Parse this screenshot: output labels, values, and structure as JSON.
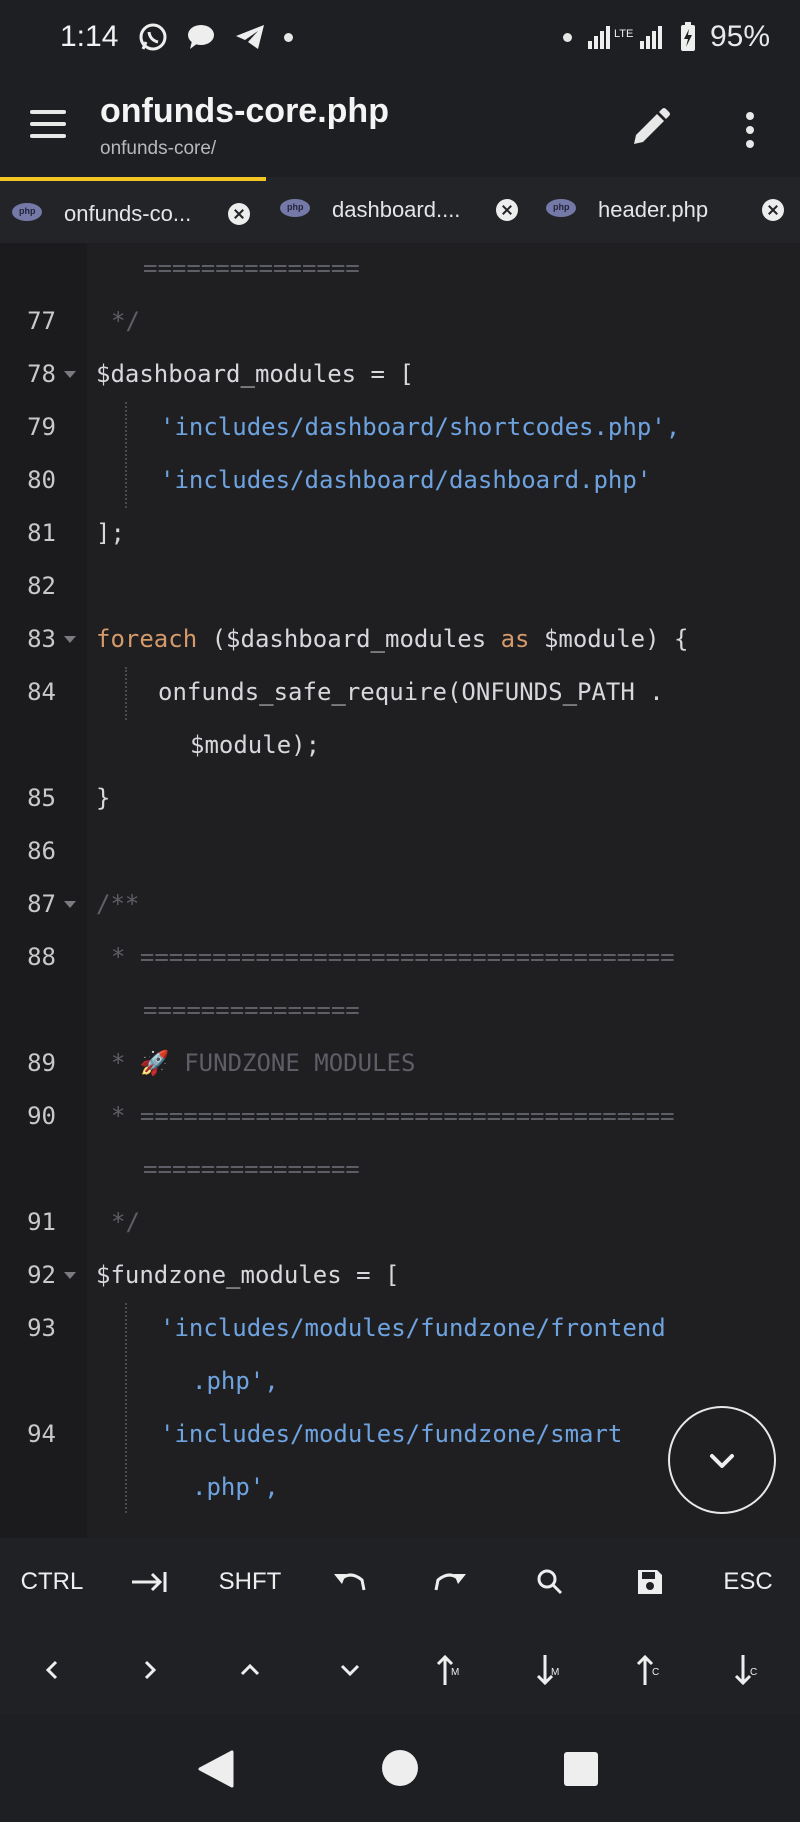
{
  "status_bar": {
    "time": "1:14",
    "battery": "95%",
    "network": "LTE"
  },
  "app_bar": {
    "title": "onfunds-core.php",
    "subtitle": "onfunds-core/"
  },
  "tabs": [
    {
      "label": "onfunds-co...",
      "icon": "php-icon",
      "active": true
    },
    {
      "label": "dashboard....",
      "icon": "php-icon",
      "active": false
    },
    {
      "label": "header.php",
      "icon": "php-icon",
      "active": false
    }
  ],
  "code_lines": [
    {
      "n": "",
      "text": "==============="
    },
    {
      "n": "77",
      "text": "*/"
    },
    {
      "n": "78",
      "text": "$dashboard_modules = ["
    },
    {
      "n": "79",
      "text": "'includes/dashboard/shortcodes.php',"
    },
    {
      "n": "80",
      "text": "'includes/dashboard/dashboard.php'"
    },
    {
      "n": "81",
      "text": "];"
    },
    {
      "n": "82",
      "text": ""
    },
    {
      "n": "83",
      "kw": "foreach",
      "text": " ($dashboard_modules ",
      "kw2": "as",
      "text2": " $module) {"
    },
    {
      "n": "84",
      "text": "onfunds_safe_require(ONFUNDS_PATH ."
    },
    {
      "n": "",
      "text": "$module);"
    },
    {
      "n": "85",
      "text": "}"
    },
    {
      "n": "86",
      "text": ""
    },
    {
      "n": "87",
      "text": "/**"
    },
    {
      "n": "88",
      "text": "* ====================================="
    },
    {
      "n": "",
      "text": "==============="
    },
    {
      "n": "89",
      "text": "* 🚀 FUNDZONE MODULES"
    },
    {
      "n": "90",
      "text": "* ====================================="
    },
    {
      "n": "",
      "text": "==============="
    },
    {
      "n": "91",
      "text": "*/"
    },
    {
      "n": "92",
      "text": "$fundzone_modules = ["
    },
    {
      "n": "93",
      "text": "'includes/modules/fundzone/frontend"
    },
    {
      "n": "",
      "text": ".php',"
    },
    {
      "n": "94",
      "text": "'includes/modules/fundzone/smart"
    },
    {
      "n": "",
      "text": ".php',"
    }
  ],
  "toolbar": {
    "row1": [
      "CTRL",
      "tab-icon",
      "SHFT",
      "undo-icon",
      "redo-icon",
      "search-icon",
      "save-icon",
      "ESC"
    ],
    "ctrl": "CTRL",
    "shft": "SHFT",
    "esc": "ESC",
    "row2": [
      "arrow-left-icon",
      "arrow-right-icon",
      "arrow-up-icon",
      "arrow-down-icon",
      "move-up-m-icon",
      "move-down-m-icon",
      "move-up-c-icon",
      "move-down-c-icon"
    ]
  },
  "colors": {
    "accent": "#f3c623",
    "string": "#6ea3e0",
    "keyword": "#d49a6a",
    "comment": "#5e5f66"
  }
}
